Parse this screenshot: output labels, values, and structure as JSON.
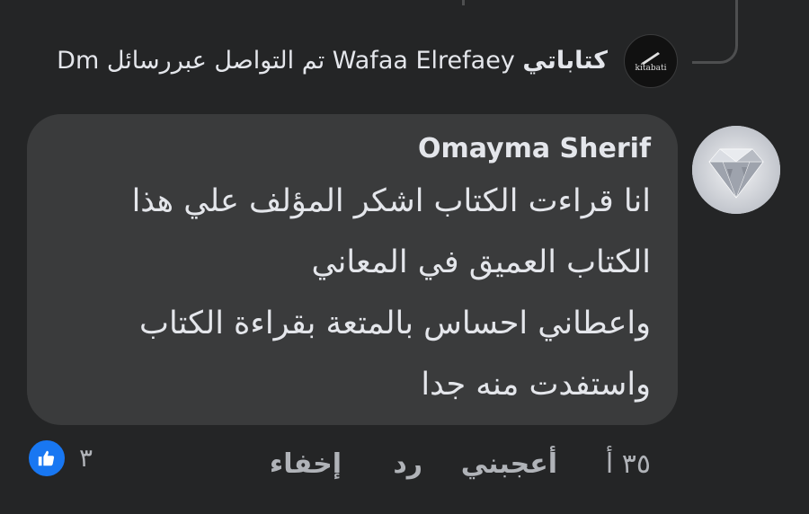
{
  "reply": {
    "page_name": "كتاباتي",
    "text": "Wafaa Elrefaey تم التواصل عبررسائل Dm",
    "avatar_logo_text": "kitabati",
    "avatar_logo_sub": ""
  },
  "comment": {
    "author": "Omayma Sherif",
    "lines": [
      "انا قراءت الكتاب اشكر المؤلف علي هذا",
      "الكتاب العميق في المعاني",
      "واعطاني احساس بالمتعة بقراءة الكتاب",
      "واستفدت منه جدا"
    ]
  },
  "actions": {
    "time": "٣٥ أ",
    "like": "أعجبني",
    "reply": "رد",
    "hide": "إخفاء"
  },
  "reactions": {
    "count": "٣",
    "icon": "like-thumbs-up-icon",
    "icon_color": "#1877f2"
  },
  "colors": {
    "background": "#242526",
    "bubble": "#3a3b3c",
    "text_primary": "#e4e6eb",
    "text_secondary": "#b0b3b8"
  }
}
